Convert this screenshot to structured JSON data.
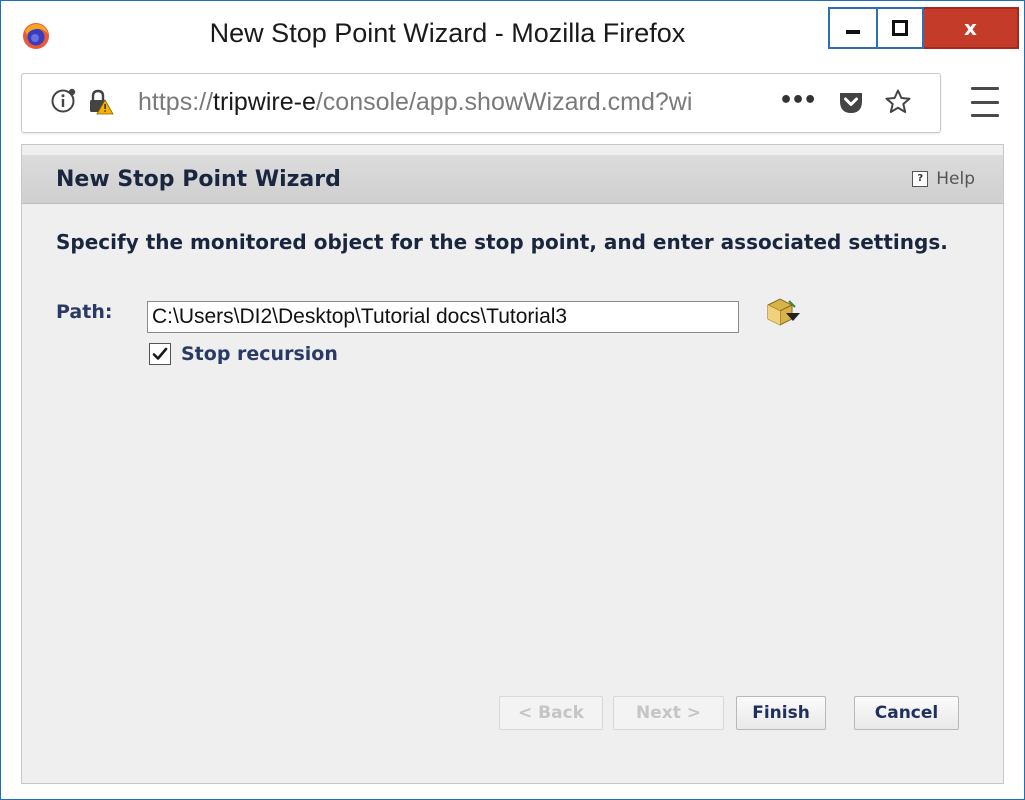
{
  "window": {
    "title": "New Stop Point Wizard - Mozilla Firefox",
    "close_glyph": "x"
  },
  "urlbar": {
    "scheme": "https://",
    "host": "tripwire-e",
    "path": "/console/app.showWizard.cmd?wi",
    "more_glyph": "•••"
  },
  "wizard": {
    "title": "New Stop Point Wizard",
    "help_label": "Help",
    "instruction": "Specify the monitored object for the stop point, and enter associated settings.",
    "path_label": "Path:",
    "path_value": "C:\\Users\\DI2\\Desktop\\Tutorial docs\\Tutorial3",
    "stop_recursion_label": "Stop recursion",
    "stop_recursion_checked": true,
    "buttons": {
      "back": "< Back",
      "next": "Next >",
      "finish": "Finish",
      "cancel": "Cancel"
    }
  },
  "colors": {
    "accent": "#1d6fb8",
    "close": "#c53b2a",
    "label_text": "#2a3a66"
  }
}
